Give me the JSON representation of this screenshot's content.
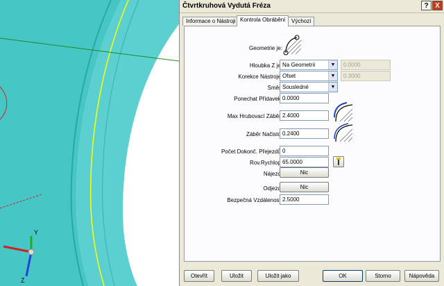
{
  "window": {
    "title": "Čtvrtkruhová Vydutá Fréza",
    "help_label": "?",
    "close_label": "X"
  },
  "tabs": [
    {
      "label": "Informace o Nástroji",
      "active": false
    },
    {
      "label": "Kontrola Obrábění",
      "active": true
    },
    {
      "label": "Výchozí",
      "active": false
    }
  ],
  "form": {
    "geometry_label": "Geometrie je:",
    "depth_z_label": "Hloubka Z je:",
    "depth_z_value": "Na Geometrii",
    "depth_z_extra": "0.0000",
    "tool_comp_label": "Korekce Nástroje:",
    "tool_comp_value": "Ofset",
    "tool_comp_extra": "0.3000",
    "direction_label": "Směr:",
    "direction_value": "Sousledné",
    "stock_label": "Ponechat Přídavek:",
    "stock_value": "0.0000",
    "max_rough_label": "Max Hrubovací Záběr:",
    "max_rough_value": "2.4000",
    "start_cut_label": "Záběr Načisto:",
    "start_cut_value": "0.2400",
    "finish_passes_label": "Počet Dokonč. Přejezdů:",
    "finish_passes_value": "0",
    "rapid_plane_label": "Rov.Rychlop:",
    "rapid_plane_value": "65.0000",
    "approach_label": "Nájezd:",
    "approach_button": "Nic",
    "retract_label": "Odjezd:",
    "retract_button": "Nic",
    "clearance_label": "Bezpečná Vzdálenost:",
    "clearance_value": "2.5000"
  },
  "buttons": {
    "open": "Otevřít",
    "save": "Uložit",
    "save_as": "Uložit jako",
    "ok": "OK",
    "cancel": "Storno",
    "help": "Nápověda"
  },
  "viewport": {
    "axis_y": "Y",
    "axis_z": "Z"
  },
  "colors": {
    "part_surface": "#47c6c6",
    "part_edge": "#2aa7a7",
    "highlight_edge": "#ffff00",
    "axis_x": "#cc2222",
    "axis_y": "#22aa22",
    "axis_z": "#2244dd"
  }
}
